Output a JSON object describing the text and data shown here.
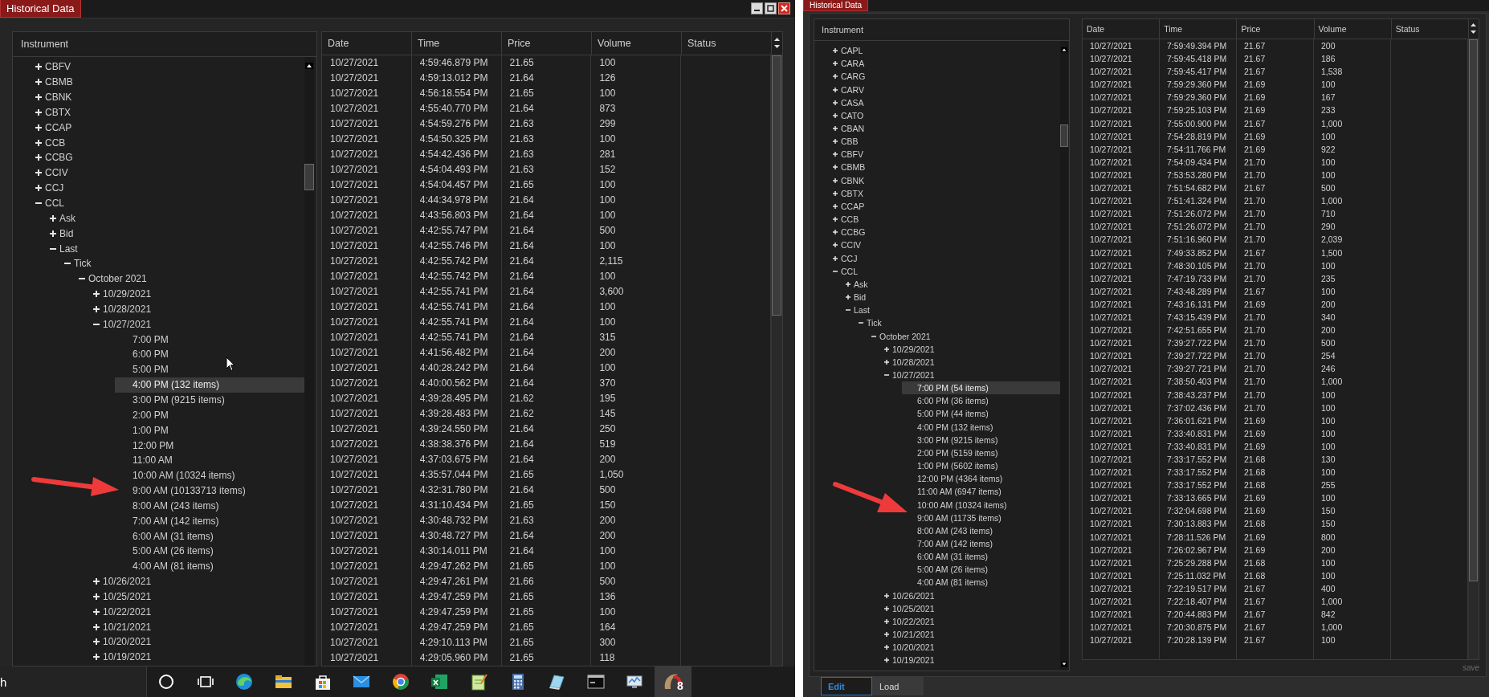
{
  "left": {
    "window": {
      "title": "Historical Data"
    },
    "tree": {
      "header": "Instrument",
      "items": [
        {
          "label": "CBFV",
          "expanded": false
        },
        {
          "label": "CBMB",
          "expanded": false
        },
        {
          "label": "CBNK",
          "expanded": false
        },
        {
          "label": "CBTX",
          "expanded": false
        },
        {
          "label": "CCAP",
          "expanded": false
        },
        {
          "label": "CCB",
          "expanded": false
        },
        {
          "label": "CCBG",
          "expanded": false
        },
        {
          "label": "CCIV",
          "expanded": false
        },
        {
          "label": "CCJ",
          "expanded": false
        },
        {
          "label": "CCL",
          "expanded": true,
          "children": [
            {
              "label": "Ask",
              "expanded": false
            },
            {
              "label": "Bid",
              "expanded": false
            },
            {
              "label": "Last",
              "expanded": true,
              "children": [
                {
                  "label": "Tick",
                  "expanded": true,
                  "children": [
                    {
                      "label": "October 2021",
                      "expanded": true,
                      "children": [
                        {
                          "label": "10/29/2021",
                          "expanded": false
                        },
                        {
                          "label": "10/28/2021",
                          "expanded": false
                        },
                        {
                          "label": "10/27/2021",
                          "expanded": true,
                          "children": [
                            {
                              "label": "7:00 PM",
                              "selected": false
                            },
                            {
                              "label": "6:00 PM",
                              "selected": false
                            },
                            {
                              "label": "5:00 PM",
                              "selected": false
                            },
                            {
                              "label": "4:00 PM (132 items)",
                              "selected": true
                            },
                            {
                              "label": "3:00 PM (9215 items)",
                              "selected": false
                            },
                            {
                              "label": "2:00 PM",
                              "selected": false
                            },
                            {
                              "label": "1:00 PM",
                              "selected": false
                            },
                            {
                              "label": "12:00 PM",
                              "selected": false
                            },
                            {
                              "label": "11:00 AM",
                              "selected": false
                            },
                            {
                              "label": "10:00 AM (10324 items)",
                              "selected": false
                            },
                            {
                              "label": "9:00 AM (10133713 items)",
                              "selected": false
                            },
                            {
                              "label": "8:00 AM (243 items)",
                              "selected": false
                            },
                            {
                              "label": "7:00 AM (142 items)",
                              "selected": false
                            },
                            {
                              "label": "6:00 AM (31 items)",
                              "selected": false
                            },
                            {
                              "label": "5:00 AM (26 items)",
                              "selected": false
                            },
                            {
                              "label": "4:00 AM (81 items)",
                              "selected": false
                            }
                          ]
                        },
                        {
                          "label": "10/26/2021",
                          "expanded": false
                        },
                        {
                          "label": "10/25/2021",
                          "expanded": false
                        },
                        {
                          "label": "10/22/2021",
                          "expanded": false
                        },
                        {
                          "label": "10/21/2021",
                          "expanded": false
                        },
                        {
                          "label": "10/20/2021",
                          "expanded": false
                        },
                        {
                          "label": "10/19/2021",
                          "expanded": false
                        }
                      ]
                    }
                  ]
                }
              ]
            }
          ]
        }
      ]
    },
    "table": {
      "columns": [
        "Date",
        "Time",
        "Price",
        "Volume",
        "Status"
      ],
      "rows": [
        [
          "10/27/2021",
          "4:59:46.879 PM",
          "21.65",
          "100"
        ],
        [
          "10/27/2021",
          "4:59:13.012 PM",
          "21.64",
          "126"
        ],
        [
          "10/27/2021",
          "4:56:18.554 PM",
          "21.65",
          "100"
        ],
        [
          "10/27/2021",
          "4:55:40.770 PM",
          "21.64",
          "873"
        ],
        [
          "10/27/2021",
          "4:54:59.276 PM",
          "21.63",
          "299"
        ],
        [
          "10/27/2021",
          "4:54:50.325 PM",
          "21.63",
          "100"
        ],
        [
          "10/27/2021",
          "4:54:42.436 PM",
          "21.63",
          "281"
        ],
        [
          "10/27/2021",
          "4:54:04.493 PM",
          "21.63",
          "152"
        ],
        [
          "10/27/2021",
          "4:54:04.457 PM",
          "21.65",
          "100"
        ],
        [
          "10/27/2021",
          "4:44:34.978 PM",
          "21.64",
          "100"
        ],
        [
          "10/27/2021",
          "4:43:56.803 PM",
          "21.64",
          "100"
        ],
        [
          "10/27/2021",
          "4:42:55.747 PM",
          "21.64",
          "500"
        ],
        [
          "10/27/2021",
          "4:42:55.746 PM",
          "21.64",
          "100"
        ],
        [
          "10/27/2021",
          "4:42:55.742 PM",
          "21.64",
          "2,115"
        ],
        [
          "10/27/2021",
          "4:42:55.742 PM",
          "21.64",
          "100"
        ],
        [
          "10/27/2021",
          "4:42:55.741 PM",
          "21.64",
          "3,600"
        ],
        [
          "10/27/2021",
          "4:42:55.741 PM",
          "21.64",
          "100"
        ],
        [
          "10/27/2021",
          "4:42:55.741 PM",
          "21.64",
          "100"
        ],
        [
          "10/27/2021",
          "4:42:55.741 PM",
          "21.64",
          "315"
        ],
        [
          "10/27/2021",
          "4:41:56.482 PM",
          "21.64",
          "200"
        ],
        [
          "10/27/2021",
          "4:40:28.242 PM",
          "21.64",
          "100"
        ],
        [
          "10/27/2021",
          "4:40:00.562 PM",
          "21.64",
          "370"
        ],
        [
          "10/27/2021",
          "4:39:28.495 PM",
          "21.62",
          "195"
        ],
        [
          "10/27/2021",
          "4:39:28.483 PM",
          "21.62",
          "145"
        ],
        [
          "10/27/2021",
          "4:39:24.550 PM",
          "21.64",
          "250"
        ],
        [
          "10/27/2021",
          "4:38:38.376 PM",
          "21.64",
          "519"
        ],
        [
          "10/27/2021",
          "4:37:03.675 PM",
          "21.64",
          "200"
        ],
        [
          "10/27/2021",
          "4:35:57.044 PM",
          "21.65",
          "1,050"
        ],
        [
          "10/27/2021",
          "4:32:31.780 PM",
          "21.64",
          "500"
        ],
        [
          "10/27/2021",
          "4:31:10.434 PM",
          "21.65",
          "150"
        ],
        [
          "10/27/2021",
          "4:30:48.732 PM",
          "21.63",
          "200"
        ],
        [
          "10/27/2021",
          "4:30:48.727 PM",
          "21.64",
          "200"
        ],
        [
          "10/27/2021",
          "4:30:14.011 PM",
          "21.64",
          "100"
        ],
        [
          "10/27/2021",
          "4:29:47.262 PM",
          "21.65",
          "100"
        ],
        [
          "10/27/2021",
          "4:29:47.261 PM",
          "21.66",
          "500"
        ],
        [
          "10/27/2021",
          "4:29:47.259 PM",
          "21.65",
          "136"
        ],
        [
          "10/27/2021",
          "4:29:47.259 PM",
          "21.65",
          "100"
        ],
        [
          "10/27/2021",
          "4:29:47.259 PM",
          "21.65",
          "164"
        ],
        [
          "10/27/2021",
          "4:29:10.113 PM",
          "21.65",
          "300"
        ],
        [
          "10/27/2021",
          "4:29:05.960 PM",
          "21.65",
          "118"
        ]
      ]
    },
    "taskbar": {
      "search_text": "h",
      "app_badge": "8"
    }
  },
  "right": {
    "window": {
      "title": "Historical Data"
    },
    "tree": {
      "header": "Instrument",
      "items": [
        {
          "label": "CAPL",
          "expanded": false
        },
        {
          "label": "CARA",
          "expanded": false
        },
        {
          "label": "CARG",
          "expanded": false
        },
        {
          "label": "CARV",
          "expanded": false
        },
        {
          "label": "CASA",
          "expanded": false
        },
        {
          "label": "CATO",
          "expanded": false
        },
        {
          "label": "CBAN",
          "expanded": false
        },
        {
          "label": "CBB",
          "expanded": false
        },
        {
          "label": "CBFV",
          "expanded": false
        },
        {
          "label": "CBMB",
          "expanded": false
        },
        {
          "label": "CBNK",
          "expanded": false
        },
        {
          "label": "CBTX",
          "expanded": false
        },
        {
          "label": "CCAP",
          "expanded": false
        },
        {
          "label": "CCB",
          "expanded": false
        },
        {
          "label": "CCBG",
          "expanded": false
        },
        {
          "label": "CCIV",
          "expanded": false
        },
        {
          "label": "CCJ",
          "expanded": false
        },
        {
          "label": "CCL",
          "expanded": true,
          "children": [
            {
              "label": "Ask",
              "expanded": false
            },
            {
              "label": "Bid",
              "expanded": false
            },
            {
              "label": "Last",
              "expanded": true,
              "children": [
                {
                  "label": "Tick",
                  "expanded": true,
                  "children": [
                    {
                      "label": "October 2021",
                      "expanded": true,
                      "children": [
                        {
                          "label": "10/29/2021",
                          "expanded": false
                        },
                        {
                          "label": "10/28/2021",
                          "expanded": false
                        },
                        {
                          "label": "10/27/2021",
                          "expanded": true,
                          "children": [
                            {
                              "label": "7:00 PM (54 items)",
                              "selected": true
                            },
                            {
                              "label": "6:00 PM (36 items)",
                              "selected": false
                            },
                            {
                              "label": "5:00 PM (44 items)",
                              "selected": false
                            },
                            {
                              "label": "4:00 PM (132 items)",
                              "selected": false
                            },
                            {
                              "label": "3:00 PM (9215 items)",
                              "selected": false
                            },
                            {
                              "label": "2:00 PM (5159 items)",
                              "selected": false
                            },
                            {
                              "label": "1:00 PM (5602 items)",
                              "selected": false
                            },
                            {
                              "label": "12:00 PM (4364 items)",
                              "selected": false
                            },
                            {
                              "label": "11:00 AM (6947 items)",
                              "selected": false
                            },
                            {
                              "label": "10:00 AM (10324 items)",
                              "selected": false
                            },
                            {
                              "label": "9:00 AM (11735 items)",
                              "selected": false
                            },
                            {
                              "label": "8:00 AM (243 items)",
                              "selected": false
                            },
                            {
                              "label": "7:00 AM (142 items)",
                              "selected": false
                            },
                            {
                              "label": "6:00 AM (31 items)",
                              "selected": false
                            },
                            {
                              "label": "5:00 AM (26 items)",
                              "selected": false
                            },
                            {
                              "label": "4:00 AM (81 items)",
                              "selected": false
                            }
                          ]
                        },
                        {
                          "label": "10/26/2021",
                          "expanded": false
                        },
                        {
                          "label": "10/25/2021",
                          "expanded": false
                        },
                        {
                          "label": "10/22/2021",
                          "expanded": false
                        },
                        {
                          "label": "10/21/2021",
                          "expanded": false
                        },
                        {
                          "label": "10/20/2021",
                          "expanded": false
                        },
                        {
                          "label": "10/19/2021",
                          "expanded": false
                        }
                      ]
                    }
                  ]
                }
              ]
            }
          ]
        }
      ]
    },
    "table": {
      "columns": [
        "Date",
        "Time",
        "Price",
        "Volume",
        "Status"
      ],
      "rows": [
        [
          "10/27/2021",
          "7:59:49.394 PM",
          "21.67",
          "200"
        ],
        [
          "10/27/2021",
          "7:59:45.418 PM",
          "21.67",
          "186"
        ],
        [
          "10/27/2021",
          "7:59:45.417 PM",
          "21.67",
          "1,538"
        ],
        [
          "10/27/2021",
          "7:59:29.360 PM",
          "21.69",
          "100"
        ],
        [
          "10/27/2021",
          "7:59:29.360 PM",
          "21.69",
          "167"
        ],
        [
          "10/27/2021",
          "7:59:25.103 PM",
          "21.69",
          "233"
        ],
        [
          "10/27/2021",
          "7:55:00.900 PM",
          "21.67",
          "1,000"
        ],
        [
          "10/27/2021",
          "7:54:28.819 PM",
          "21.69",
          "100"
        ],
        [
          "10/27/2021",
          "7:54:11.766 PM",
          "21.69",
          "922"
        ],
        [
          "10/27/2021",
          "7:54:09.434 PM",
          "21.70",
          "100"
        ],
        [
          "10/27/2021",
          "7:53:53.280 PM",
          "21.70",
          "100"
        ],
        [
          "10/27/2021",
          "7:51:54.682 PM",
          "21.67",
          "500"
        ],
        [
          "10/27/2021",
          "7:51:41.324 PM",
          "21.70",
          "1,000"
        ],
        [
          "10/27/2021",
          "7:51:26.072 PM",
          "21.70",
          "710"
        ],
        [
          "10/27/2021",
          "7:51:26.072 PM",
          "21.70",
          "290"
        ],
        [
          "10/27/2021",
          "7:51:16.960 PM",
          "21.70",
          "2,039"
        ],
        [
          "10/27/2021",
          "7:49:33.852 PM",
          "21.67",
          "1,500"
        ],
        [
          "10/27/2021",
          "7:48:30.105 PM",
          "21.70",
          "100"
        ],
        [
          "10/27/2021",
          "7:47:19.733 PM",
          "21.70",
          "235"
        ],
        [
          "10/27/2021",
          "7:43:48.289 PM",
          "21.67",
          "100"
        ],
        [
          "10/27/2021",
          "7:43:16.131 PM",
          "21.69",
          "200"
        ],
        [
          "10/27/2021",
          "7:43:15.439 PM",
          "21.70",
          "340"
        ],
        [
          "10/27/2021",
          "7:42:51.655 PM",
          "21.70",
          "200"
        ],
        [
          "10/27/2021",
          "7:39:27.722 PM",
          "21.70",
          "500"
        ],
        [
          "10/27/2021",
          "7:39:27.722 PM",
          "21.70",
          "254"
        ],
        [
          "10/27/2021",
          "7:39:27.721 PM",
          "21.70",
          "246"
        ],
        [
          "10/27/2021",
          "7:38:50.403 PM",
          "21.70",
          "1,000"
        ],
        [
          "10/27/2021",
          "7:38:43.237 PM",
          "21.70",
          "100"
        ],
        [
          "10/27/2021",
          "7:37:02.436 PM",
          "21.70",
          "100"
        ],
        [
          "10/27/2021",
          "7:36:01.621 PM",
          "21.69",
          "100"
        ],
        [
          "10/27/2021",
          "7:33:40.831 PM",
          "21.69",
          "100"
        ],
        [
          "10/27/2021",
          "7:33:40.831 PM",
          "21.69",
          "100"
        ],
        [
          "10/27/2021",
          "7:33:17.552 PM",
          "21.68",
          "130"
        ],
        [
          "10/27/2021",
          "7:33:17.552 PM",
          "21.68",
          "100"
        ],
        [
          "10/27/2021",
          "7:33:17.552 PM",
          "21.68",
          "255"
        ],
        [
          "10/27/2021",
          "7:33:13.665 PM",
          "21.69",
          "100"
        ],
        [
          "10/27/2021",
          "7:32:04.698 PM",
          "21.69",
          "150"
        ],
        [
          "10/27/2021",
          "7:30:13.883 PM",
          "21.68",
          "150"
        ],
        [
          "10/27/2021",
          "7:28:11.526 PM",
          "21.69",
          "800"
        ],
        [
          "10/27/2021",
          "7:26:02.967 PM",
          "21.69",
          "200"
        ],
        [
          "10/27/2021",
          "7:25:29.288 PM",
          "21.68",
          "100"
        ],
        [
          "10/27/2021",
          "7:25:11.032 PM",
          "21.68",
          "100"
        ],
        [
          "10/27/2021",
          "7:22:19.517 PM",
          "21.67",
          "400"
        ],
        [
          "10/27/2021",
          "7:22:18.407 PM",
          "21.67",
          "1,000"
        ],
        [
          "10/27/2021",
          "7:20:44.883 PM",
          "21.67",
          "842"
        ],
        [
          "10/27/2021",
          "7:20:30.875 PM",
          "21.67",
          "1,000"
        ],
        [
          "10/27/2021",
          "7:20:28.139 PM",
          "21.67",
          "100"
        ]
      ]
    },
    "save_label": "save",
    "tabs": [
      {
        "label": "Edit",
        "selected": true
      },
      {
        "label": "Load",
        "selected": false
      }
    ]
  }
}
